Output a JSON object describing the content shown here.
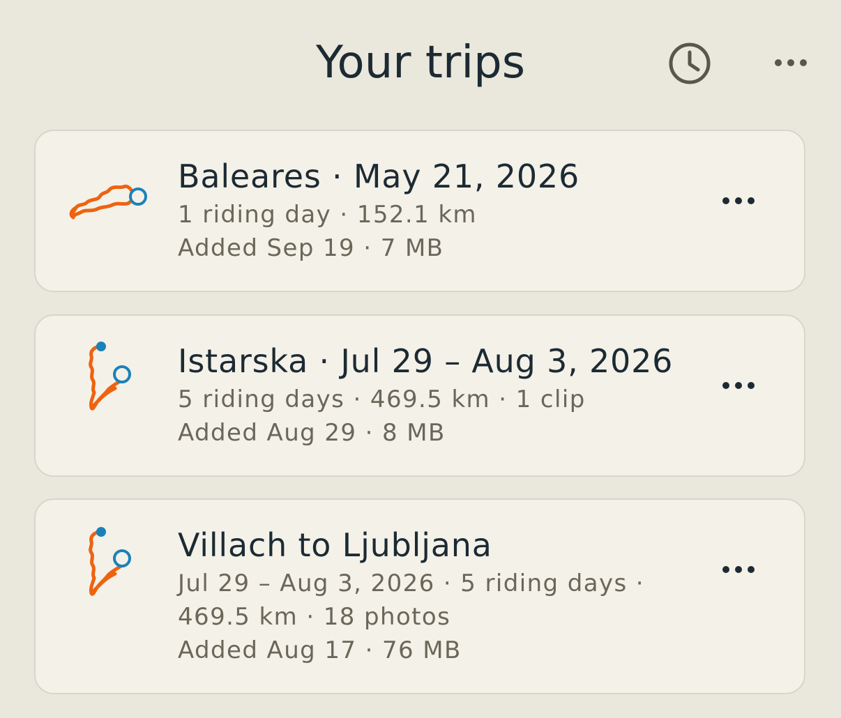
{
  "header": {
    "title": "Your trips",
    "history_icon": "clock-icon",
    "more_icon": "more-horizontal-icon"
  },
  "colors": {
    "background": "#eae7dc",
    "card": "#f4f1e9",
    "route": "#ee6310",
    "marker": "#1a82b8",
    "text": "#1c2a33",
    "secondary_text": "#6a6759"
  },
  "trips": [
    {
      "title": "Baleares · May 21, 2026",
      "meta": [
        "1 riding day · 152.1 km",
        "Added Sep 19 · 7 MB"
      ]
    },
    {
      "title": "Istarska · Jul 29 – Aug 3, 2026",
      "meta": [
        "5 riding days · 469.5 km · 1 clip",
        "Added Aug 29 · 8 MB"
      ]
    },
    {
      "title": "Villach to Ljubljana",
      "meta": [
        "Jul 29 – Aug 3, 2026 · 5 riding days ·",
        "469.5 km · 18 photos",
        "Added Aug 17 · 76 MB"
      ]
    }
  ]
}
